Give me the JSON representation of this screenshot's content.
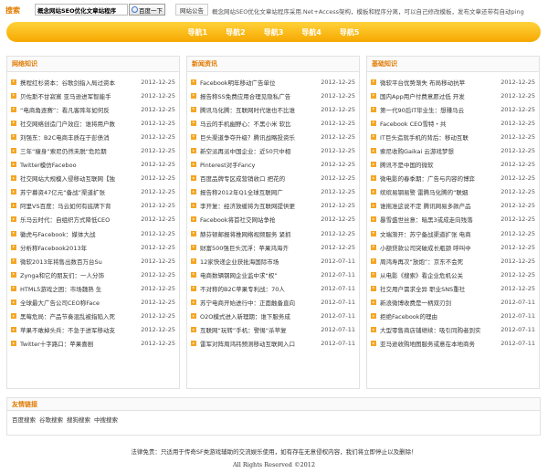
{
  "search": {
    "label": "搜索",
    "value": "概念网站SEO优化文章站程序",
    "button": "百度一下"
  },
  "notice": {
    "tag": "网站公告",
    "text": "概念网站SEO优化文章站程序采用.Net+Access架构，模板和程序分离，可以自己修改模板，发布文章还带有自动ping"
  },
  "nav": [
    "导航1",
    "导航2",
    "导航3",
    "导航4",
    "导航5"
  ],
  "columns": [
    {
      "title": "网络知识",
      "items": [
        {
          "t": "携程红杉资本：谷歌剑指入局过资本",
          "d": "2012-12-25"
        },
        {
          "t": "贝佐斯不甘寂寞 亚马逊进军智能手",
          "d": "2012-12-25"
        },
        {
          "t": "“电商角逐赛”：看凡客阵年如何反",
          "d": "2012-12-25"
        },
        {
          "t": "社交网络创造门户效应：谁将用户数",
          "d": "2012-12-25"
        },
        {
          "t": "刘强东：B2C电商丰质在于彭债消",
          "d": "2012-12-25"
        },
        {
          "t": "三年“瘦身”索尼仍然未脱“危险期",
          "d": "2012-12-25"
        },
        {
          "t": "Twitter模仿Faceboo",
          "d": "2012-12-25"
        },
        {
          "t": "社交网站大规模入侵移动互联网【独",
          "d": "2012-12-25"
        },
        {
          "t": "苏宁募资47亿元“备战”渠道扩张",
          "d": "2012-12-25"
        },
        {
          "t": "阿里VS百度：马云如何有底牌下背",
          "d": "2012-12-25"
        },
        {
          "t": "乐马云时代：自组织方式降低CEO",
          "d": "2012-12-25"
        },
        {
          "t": "徽虎与Facebook：媒体大战",
          "d": "2012-12-25"
        },
        {
          "t": "分析称Facebook2013年",
          "d": "2012-12-25"
        },
        {
          "t": "微软2013年将售出数百万台Su",
          "d": "2012-12-25"
        },
        {
          "t": "Zynga和它的朋友们：一人分饰",
          "d": "2012-12-25"
        },
        {
          "t": "HTML5游戏之困：市场魏熟 生",
          "d": "2012-12-25"
        },
        {
          "t": "全球最大广告公司CEO称Face",
          "d": "2012-12-25"
        },
        {
          "t": "黑莓危局：产品节奏混乱被指陷入死",
          "d": "2012-12-25"
        },
        {
          "t": "苹果不敢掉头兵：不急于进军移动支",
          "d": "2012-12-25"
        },
        {
          "t": "Twitter十字路口：苹果喜剧",
          "d": "2012-12-25"
        }
      ]
    },
    {
      "title": "新闻资讯",
      "items": [
        {
          "t": "Facebook明年移动广告单位",
          "d": "2012-12-25"
        },
        {
          "t": "报告称SS免费应用合理见隐私广告",
          "d": "2012-12-25"
        },
        {
          "t": "腾讯马化腾：互联网时代谁也不比谁",
          "d": "2012-12-25"
        },
        {
          "t": "马云的手机幽野心：不黑小米 软比",
          "d": "2012-12-25"
        },
        {
          "t": "巨头渠道争夺升级？腾讯战略投资乐",
          "d": "2012-12-25"
        },
        {
          "t": "新空派再派中国企业：近50只中相",
          "d": "2012-12-25"
        },
        {
          "t": "Pinterest对手Fancy",
          "d": "2012-12-25"
        },
        {
          "t": "百度品牌专区成营销收口 把花的",
          "d": "2012-12-25"
        },
        {
          "t": "报告称2012年Q1全球互联网广",
          "d": "2012-12-25"
        },
        {
          "t": "李开复：经济放缓将为互联网提供更",
          "d": "2012-12-25"
        },
        {
          "t": "Facebook将首社交网站争抢",
          "d": "2012-12-25"
        },
        {
          "t": "赫芬顿邮报将推网络视频服务 紧抓",
          "d": "2012-12-25"
        },
        {
          "t": "财富500强巨头沉浮：苹果鸿海齐",
          "d": "2012-12-25"
        },
        {
          "t": "12家快递企业获批海国际市场",
          "d": "2012-07-11"
        },
        {
          "t": "电商数辆钢网企业监中求“权”",
          "d": "2012-07-11"
        },
        {
          "t": "不对称的B2C苹果专利战：70人",
          "d": "2012-07-11"
        },
        {
          "t": "苏宁电商开始进行中：正面触备直向",
          "d": "2012-07-11"
        },
        {
          "t": "O2O模式进入新理期：谁下服务成",
          "d": "2012-07-11"
        },
        {
          "t": "互联网“玩转”手机：警惕“杀苹复",
          "d": "2012-07-11"
        },
        {
          "t": "雷军对阵周鸿祎预测移动互联网入口",
          "d": "2012-07-11"
        }
      ]
    },
    {
      "title": "基础知识",
      "items": [
        {
          "t": "微软平台优势渐失 布局移动抗苹",
          "d": "2012-12-25"
        },
        {
          "t": "国内App用户付费意愿过低 开发",
          "d": "2012-12-25"
        },
        {
          "t": "第一代90后IT毕业生：想赚马云",
          "d": "2012-12-25"
        },
        {
          "t": "Facebook CEO雪特・共",
          "d": "2012-12-25"
        },
        {
          "t": "IT巨头造就手机的背后：移动互联",
          "d": "2012-12-25"
        },
        {
          "t": "索尼收购Gaikai 云游戏梦想",
          "d": "2012-12-25"
        },
        {
          "t": "腾讯不是中国的微软",
          "d": "2012-12-25"
        },
        {
          "t": "微电影的春季期：广告与内容的博弈",
          "d": "2012-12-25"
        },
        {
          "t": "缤缤易钢易警 雷腾马化腾的“联姻",
          "d": "2012-12-25"
        },
        {
          "t": "谁拖准这说不定 腾讯网易多款产品",
          "d": "2012-12-25"
        },
        {
          "t": "暴雪盛世丝意：暗黑3或成走向残落",
          "d": "2012-12-25"
        },
        {
          "t": "文端渐开：苏宁备战渠道扩张 电商",
          "d": "2012-12-25"
        },
        {
          "t": "小额贷款公司突破成长瓶颈 呼叫中",
          "d": "2012-12-25"
        },
        {
          "t": "周鸿寿再次“放炮”：京东不会死",
          "d": "2012-12-25"
        },
        {
          "t": "从电影《搜索》看企业危机公关",
          "d": "2012-12-25"
        },
        {
          "t": "社交用户需求全异 职业SNS重社",
          "d": "2012-12-25"
        },
        {
          "t": "新浪微博收费是一柄双刃剑",
          "d": "2012-07-11"
        },
        {
          "t": "拒绝Facebook的理由",
          "d": "2012-07-11"
        },
        {
          "t": "大型零售商店铺继续：吸引同购者到实",
          "d": "2012-07-11"
        },
        {
          "t": "亚马逊收购地图服务或意在本地商务",
          "d": "2012-07-11"
        }
      ]
    }
  ],
  "links": {
    "title": "友情链接",
    "items": [
      "百度搜索",
      "谷歌搜索",
      "搜狗搜索",
      "中搜搜索"
    ]
  },
  "footer": {
    "disclaimer": "法律免责：只适用于传奇SF类游戏辅助的交流娱乐使用，如有存在无意侵权内容，我们将立即停止以及删除！",
    "copyright": "All Rights Reserved ©2012"
  }
}
